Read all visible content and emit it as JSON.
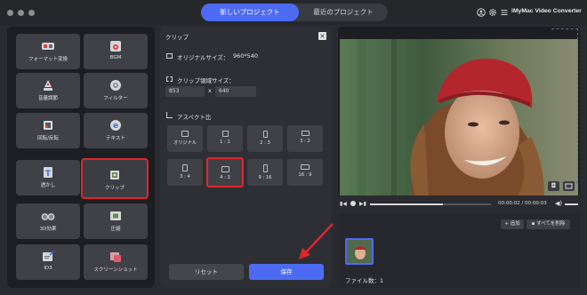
{
  "header": {
    "tabs": [
      {
        "label": "新しいプロジェクト",
        "active": true
      },
      {
        "label": "最近のプロジェクト",
        "active": false
      }
    ],
    "app_title": "iMyMac Video Converter",
    "icons": [
      "user-icon",
      "gear-icon",
      "menu-icon"
    ]
  },
  "tools": [
    {
      "label": "フォーマット変換",
      "icon": "format-convert-icon"
    },
    {
      "label": "BGM",
      "icon": "music-icon"
    },
    {
      "label": "音量調節",
      "icon": "volume-icon"
    },
    {
      "label": "フィルター",
      "icon": "filter-icon"
    },
    {
      "label": "回転/反転",
      "icon": "rotate-icon"
    },
    {
      "label": "テキスト",
      "icon": "text-icon"
    },
    {
      "label": "透かし",
      "icon": "watermark-icon"
    },
    {
      "label": "クリップ",
      "icon": "crop-icon",
      "selected": true
    },
    {
      "label": "3D効果",
      "icon": "3d-glasses-icon"
    },
    {
      "label": "圧縮",
      "icon": "compress-icon"
    },
    {
      "label": "ID3",
      "icon": "id3-icon"
    },
    {
      "label": "スクリーンショット",
      "icon": "screenshot-icon"
    }
  ],
  "clip": {
    "title": "クリップ",
    "original_size_label": "オリジナルサイズ：",
    "original_size_value": "960*540",
    "clip_area_label": "クリップ領域サイズ：",
    "width": "853",
    "times": "x",
    "height": "640",
    "aspect_label": "アスペクト比",
    "ratios": [
      {
        "label": "オリジナル"
      },
      {
        "label": "1 : 1"
      },
      {
        "label": "2 : 3"
      },
      {
        "label": "3 : 2"
      },
      {
        "label": "3 : 4"
      },
      {
        "label": "4 : 3",
        "selected": true
      },
      {
        "label": "9 : 16"
      },
      {
        "label": "16 : 9"
      }
    ],
    "reset_label": "リセット",
    "save_label": "保存"
  },
  "player": {
    "time": "00:00:02 / 00:00:03",
    "progress": 0.6
  },
  "files": {
    "add_label": "追加",
    "delete_all_label": "すべてを削除",
    "count_label": "ファイル数：1"
  },
  "colors": {
    "accent": "#4d6bf2",
    "highlight": "#e0262b"
  }
}
